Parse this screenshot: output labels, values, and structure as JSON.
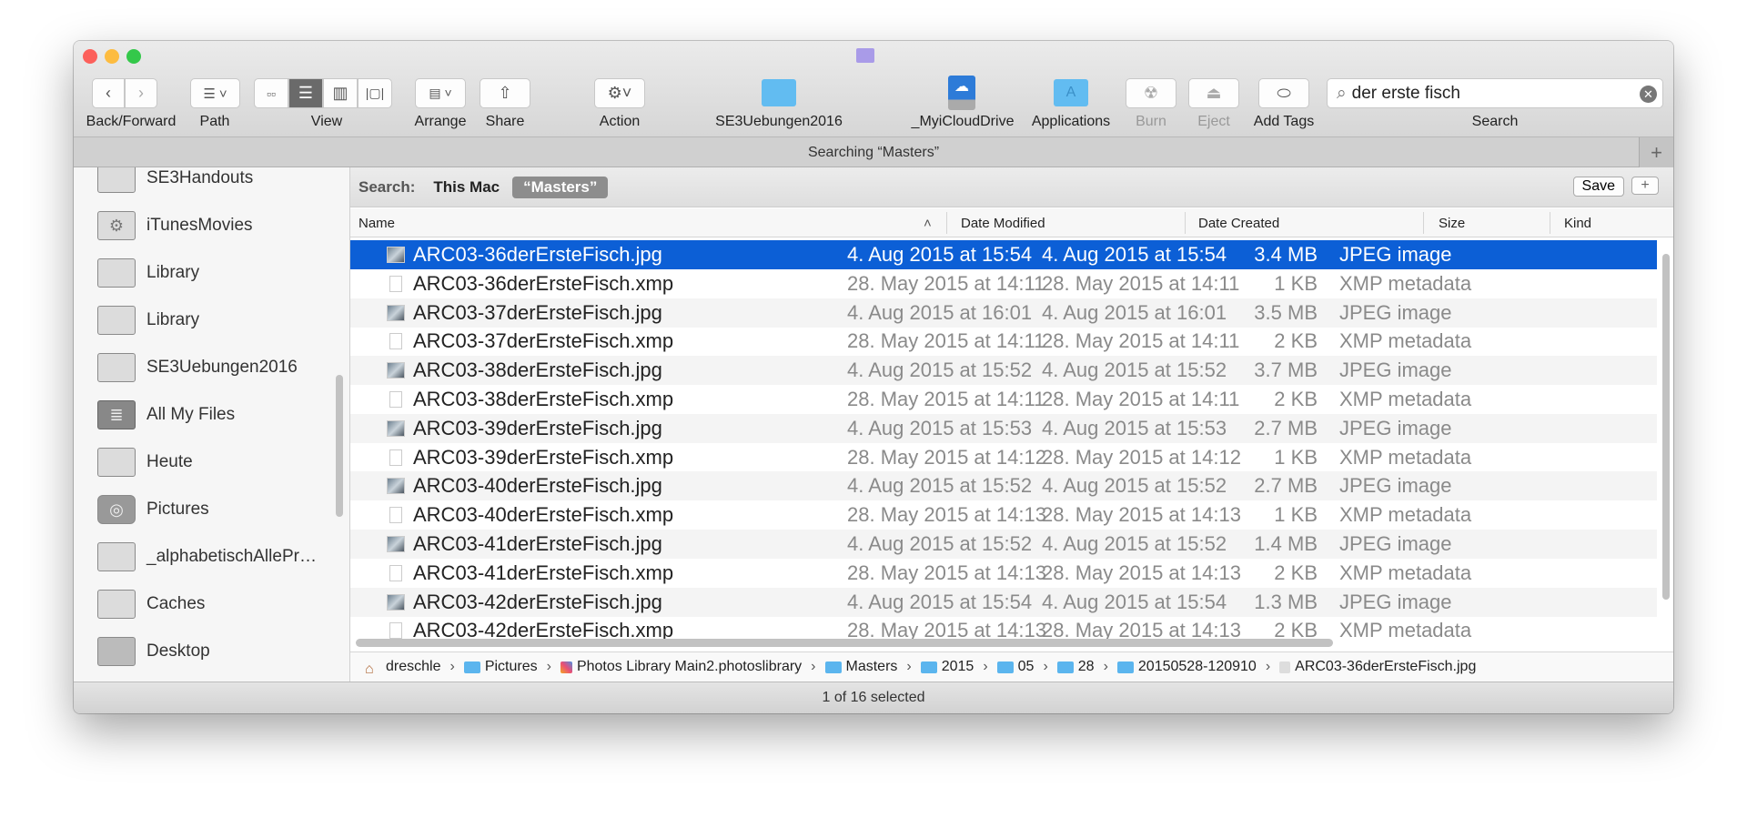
{
  "window": {
    "proxy_icon": "purple-folder-icon"
  },
  "toolbar": {
    "back_forward": "Back/Forward",
    "path": "Path",
    "view": "View",
    "arrange": "Arrange",
    "share": "Share",
    "action": "Action",
    "fav1": "SE3Uebungen2016",
    "fav2": "_MyiCloudDrive",
    "fav3": "Applications",
    "burn": "Burn",
    "eject": "Eject",
    "add_tags": "Add Tags",
    "search_value": "der erste fisch",
    "search_label": "Search"
  },
  "tabbar": {
    "title": "Searching “Masters”",
    "add": "+"
  },
  "sidebar": {
    "items": [
      {
        "label": "SE3Handouts",
        "icon": "folder-icon"
      },
      {
        "label": "iTunesMovies",
        "icon": "gear-folder-icon"
      },
      {
        "label": "Library",
        "icon": "folder-icon"
      },
      {
        "label": "Library",
        "icon": "folder-icon"
      },
      {
        "label": "SE3Uebungen2016",
        "icon": "folder-icon"
      },
      {
        "label": "All My Files",
        "icon": "all-files-icon"
      },
      {
        "label": "Heute",
        "icon": "folder-icon"
      },
      {
        "label": "Pictures",
        "icon": "camera-icon"
      },
      {
        "label": "_alphabetischAllePr…",
        "icon": "folder-icon"
      },
      {
        "label": "Caches",
        "icon": "folder-icon"
      },
      {
        "label": "Desktop",
        "icon": "desktop-icon"
      }
    ]
  },
  "scope": {
    "label": "Search:",
    "this_mac": "This Mac",
    "masters": "“Masters”",
    "save": "Save",
    "add": "+"
  },
  "columns": {
    "name": "Name",
    "modified": "Date Modified",
    "created": "Date Created",
    "size": "Size",
    "kind": "Kind"
  },
  "rows": [
    {
      "name": "ARC03-36derErsteFisch.jpg",
      "modified": "4. Aug 2015 at 15:54",
      "created": "4. Aug 2015 at 15:54",
      "size": "3.4 MB",
      "kind": "JPEG image"
    },
    {
      "name": "ARC03-36derErsteFisch.xmp",
      "modified": "28. May 2015 at 14:11",
      "created": "28. May 2015 at 14:11",
      "size": "1 KB",
      "kind": "XMP metadata"
    },
    {
      "name": "ARC03-37derErsteFisch.jpg",
      "modified": "4. Aug 2015 at 16:01",
      "created": "4. Aug 2015 at 16:01",
      "size": "3.5 MB",
      "kind": "JPEG image"
    },
    {
      "name": "ARC03-37derErsteFisch.xmp",
      "modified": "28. May 2015 at 14:11",
      "created": "28. May 2015 at 14:11",
      "size": "2 KB",
      "kind": "XMP metadata"
    },
    {
      "name": "ARC03-38derErsteFisch.jpg",
      "modified": "4. Aug 2015 at 15:52",
      "created": "4. Aug 2015 at 15:52",
      "size": "3.7 MB",
      "kind": "JPEG image"
    },
    {
      "name": "ARC03-38derErsteFisch.xmp",
      "modified": "28. May 2015 at 14:11",
      "created": "28. May 2015 at 14:11",
      "size": "2 KB",
      "kind": "XMP metadata"
    },
    {
      "name": "ARC03-39derErsteFisch.jpg",
      "modified": "4. Aug 2015 at 15:53",
      "created": "4. Aug 2015 at 15:53",
      "size": "2.7 MB",
      "kind": "JPEG image"
    },
    {
      "name": "ARC03-39derErsteFisch.xmp",
      "modified": "28. May 2015 at 14:12",
      "created": "28. May 2015 at 14:12",
      "size": "1 KB",
      "kind": "XMP metadata"
    },
    {
      "name": "ARC03-40derErsteFisch.jpg",
      "modified": "4. Aug 2015 at 15:52",
      "created": "4. Aug 2015 at 15:52",
      "size": "2.7 MB",
      "kind": "JPEG image"
    },
    {
      "name": "ARC03-40derErsteFisch.xmp",
      "modified": "28. May 2015 at 14:13",
      "created": "28. May 2015 at 14:13",
      "size": "1 KB",
      "kind": "XMP metadata"
    },
    {
      "name": "ARC03-41derErsteFisch.jpg",
      "modified": "4. Aug 2015 at 15:52",
      "created": "4. Aug 2015 at 15:52",
      "size": "1.4 MB",
      "kind": "JPEG image"
    },
    {
      "name": "ARC03-41derErsteFisch.xmp",
      "modified": "28. May 2015 at 14:13",
      "created": "28. May 2015 at 14:13",
      "size": "2 KB",
      "kind": "XMP metadata"
    },
    {
      "name": "ARC03-42derErsteFisch.jpg",
      "modified": "4. Aug 2015 at 15:54",
      "created": "4. Aug 2015 at 15:54",
      "size": "1.3 MB",
      "kind": "JPEG image"
    },
    {
      "name": "ARC03-42derErsteFisch.xmp",
      "modified": "28. May 2015 at 14:13",
      "created": "28. May 2015 at 14:13",
      "size": "2 KB",
      "kind": "XMP metadata"
    }
  ],
  "path": [
    "dreschle",
    "Pictures",
    "Photos Library Main2.photoslibrary",
    "Masters",
    "2015",
    "05",
    "28",
    "20150528-120910",
    "ARC03-36derErsteFisch.jpg"
  ],
  "status": "1 of 16 selected",
  "colors": {
    "selection": "#0c5fd6",
    "folder": "#5bb5ee"
  }
}
